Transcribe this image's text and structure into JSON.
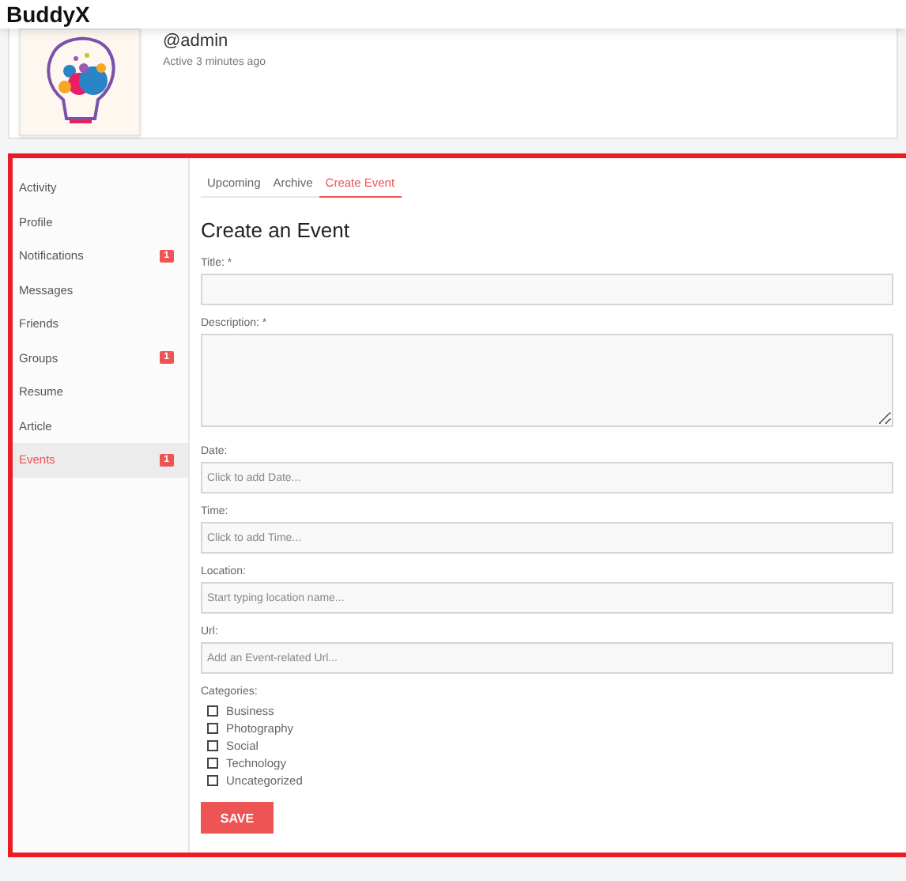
{
  "header": {
    "site_title": "BuddyX"
  },
  "profile": {
    "handle": "@admin",
    "activity": "Active 3 minutes ago"
  },
  "sidebar": {
    "items": [
      {
        "label": "Activity",
        "selected": false
      },
      {
        "label": "Profile",
        "selected": false
      },
      {
        "label": "Notifications",
        "selected": false,
        "badge": "1"
      },
      {
        "label": "Messages",
        "selected": false
      },
      {
        "label": "Friends",
        "selected": false
      },
      {
        "label": "Groups",
        "selected": false,
        "badge": "1"
      },
      {
        "label": "Resume",
        "selected": false
      },
      {
        "label": "Article",
        "selected": false
      },
      {
        "label": "Events",
        "selected": true,
        "badge": "1"
      }
    ]
  },
  "tabs": [
    {
      "label": "Upcoming",
      "selected": false
    },
    {
      "label": "Archive",
      "selected": false
    },
    {
      "label": "Create Event",
      "selected": true
    }
  ],
  "form": {
    "heading": "Create an Event",
    "fields": [
      {
        "kind": "text",
        "label": "Title: *"
      },
      {
        "kind": "textarea",
        "label": "Description: *"
      },
      {
        "kind": "text",
        "label": "Date:",
        "placeholder": "Click to add Date..."
      },
      {
        "kind": "text",
        "label": "Time:",
        "placeholder": "Click to add Time..."
      },
      {
        "kind": "text",
        "label": "Location:",
        "placeholder": "Start typing location name..."
      },
      {
        "kind": "text",
        "label": "Url:",
        "placeholder": "Add an Event-related Url..."
      }
    ],
    "categories_label": "Categories:",
    "categories": [
      {
        "label": "Business",
        "checked": false
      },
      {
        "label": "Photography",
        "checked": false
      },
      {
        "label": "Social",
        "checked": false
      },
      {
        "label": "Technology",
        "checked": false
      },
      {
        "label": "Uncategorized",
        "checked": false
      }
    ],
    "save_button": "SAVE"
  }
}
